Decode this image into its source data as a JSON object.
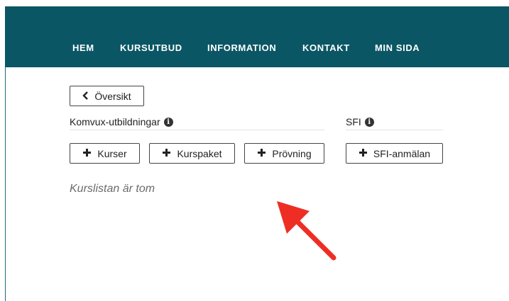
{
  "nav": {
    "items": [
      {
        "label": "HEM"
      },
      {
        "label": "KURSUTBUD"
      },
      {
        "label": "INFORMATION"
      },
      {
        "label": "KONTAKT"
      },
      {
        "label": "MIN SIDA"
      }
    ]
  },
  "overview_button": {
    "label": "Översikt",
    "icon": "chevron-left-icon"
  },
  "komvux": {
    "heading": "Komvux-utbildningar",
    "buttons": [
      {
        "label": "Kurser",
        "icon": "plus-icon"
      },
      {
        "label": "Kurspaket",
        "icon": "plus-icon"
      },
      {
        "label": "Prövning",
        "icon": "plus-icon"
      }
    ]
  },
  "sfi": {
    "heading": "SFI",
    "buttons": [
      {
        "label": "SFI-anmälan",
        "icon": "plus-icon"
      }
    ]
  },
  "empty_message": "Kurslistan är tom",
  "colors": {
    "header": "#0b5665",
    "annotation_arrow": "#ee2e24"
  }
}
